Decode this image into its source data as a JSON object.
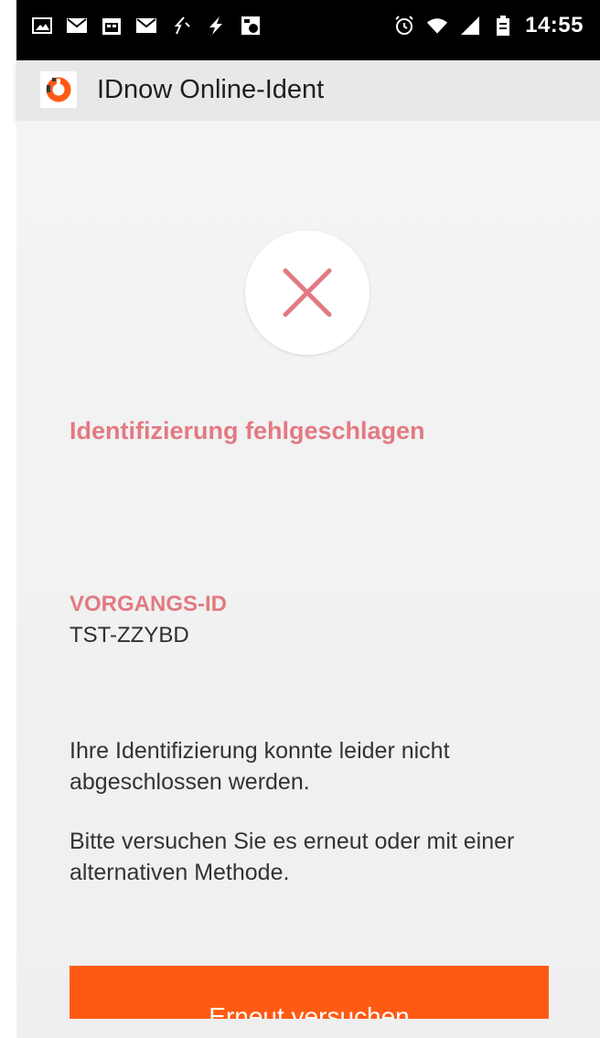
{
  "status_bar": {
    "time": "14:55",
    "left_icons": [
      "image-icon",
      "mail-icon",
      "calendar-icon",
      "mail-icon",
      "vibrate-icon",
      "lightning-icon",
      "app-notification-icon"
    ],
    "right_icons": [
      "alarm-icon",
      "wifi-icon",
      "signal-icon",
      "battery-icon"
    ]
  },
  "app_bar": {
    "title": "IDnow Online-Ident"
  },
  "content": {
    "status_icon": "close-icon",
    "headline": "Identifizierung fehlgeschlagen",
    "id_label": "VORGANGS-ID",
    "id_value": "TST-ZZYBD",
    "message_1": "Ihre Identifizierung konnte leider nicht abgeschlossen werden.",
    "message_2": "Bitte versuchen Sie es erneut oder mit einer alternativen Methode.",
    "button_label": "Erneut versuchen"
  },
  "colors": {
    "accent_orange": "#ff5a14",
    "error_pink": "#e27a82"
  }
}
